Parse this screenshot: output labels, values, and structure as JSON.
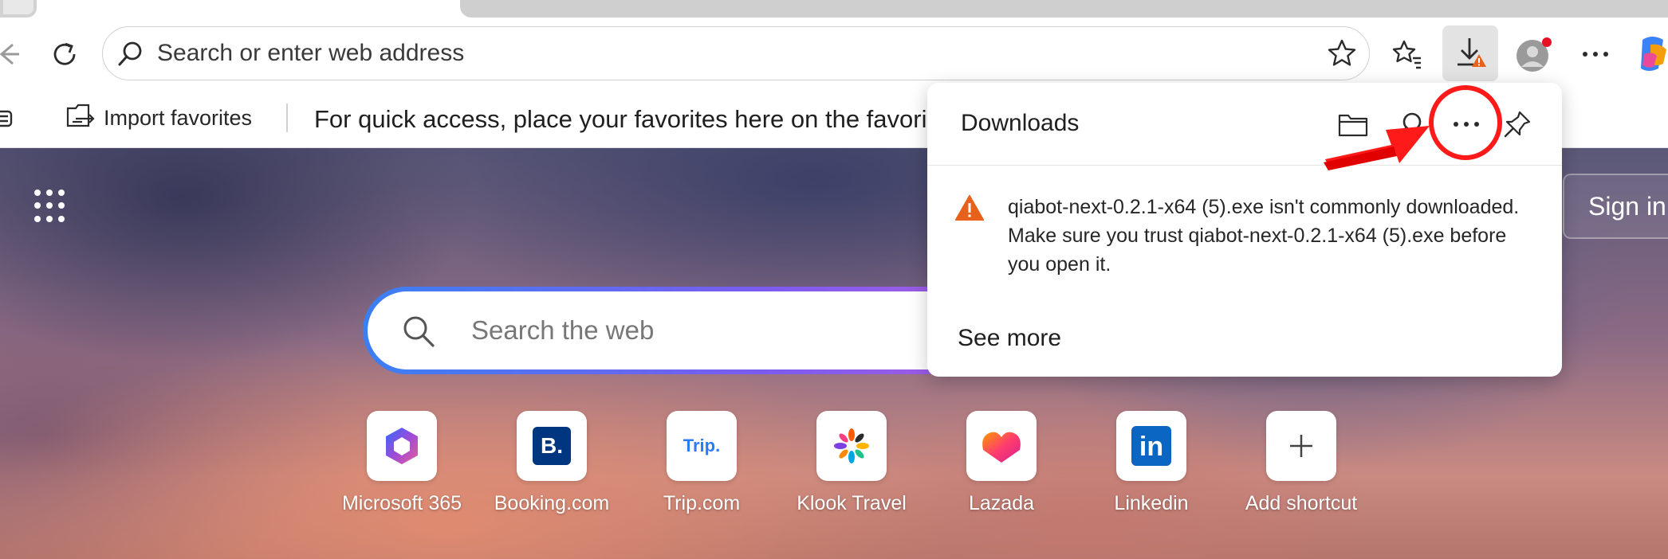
{
  "toolbar": {
    "address_placeholder": "Search or enter web address"
  },
  "favorites_bar": {
    "import_label": "Import favorites",
    "hint": "For quick access, place your favorites here on the favorite"
  },
  "ntp": {
    "signin_label": "Sign in",
    "search_placeholder": "Search the web",
    "shortcuts": [
      {
        "label": "Microsoft 365",
        "icon": "microsoft-365-icon"
      },
      {
        "label": "Booking.com",
        "icon": "booking-icon"
      },
      {
        "label": "Trip.com",
        "icon": "trip-icon"
      },
      {
        "label": "Klook Travel",
        "icon": "klook-icon"
      },
      {
        "label": "Lazada",
        "icon": "lazada-icon"
      },
      {
        "label": "Linkedin",
        "icon": "linkedin-icon"
      },
      {
        "label": "Add shortcut",
        "icon": "plus-icon"
      }
    ],
    "booking_glyph": "B.",
    "trip_glyph": "Trip.",
    "linkedin_glyph": "in"
  },
  "downloads": {
    "title": "Downloads",
    "warning_message": "qiabot-next-0.2.1-x64 (5).exe isn't commonly downloaded. Make sure you trust qiabot-next-0.2.1-x64 (5).exe before you open it.",
    "see_more": "See more"
  },
  "colors": {
    "warning": "#e8611a",
    "annotation_red": "#ff1a1a",
    "search_gradient_start": "#3b7ff2",
    "search_gradient_end": "#c75bd8",
    "booking_blue": "#003580",
    "trip_blue": "#287dfa",
    "linkedin_blue": "#0a66c2"
  }
}
